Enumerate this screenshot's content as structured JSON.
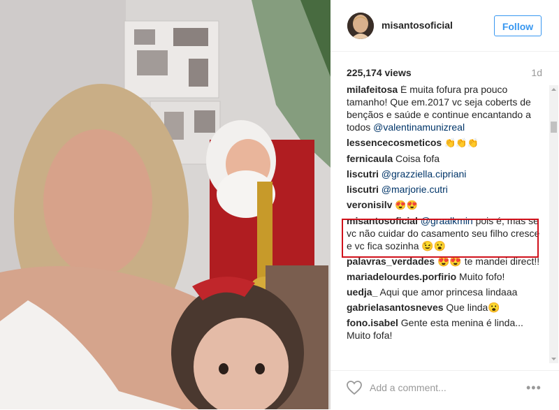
{
  "post": {
    "username": "misantosoficial",
    "follow_label": "Follow",
    "views": "225,174 views",
    "age": "1d"
  },
  "comments": [
    {
      "user": "milafeitosa",
      "text": "É muita fofura pra pouco tamanho! Que em.2017 vc seja coberts de bençãos e saúde e continue encantando a todos",
      "mention": "@valentinamunizreal",
      "after": ""
    },
    {
      "user": "lessencecosmeticos",
      "text": "👏👏👏",
      "mention": "",
      "after": ""
    },
    {
      "user": "fernicaula",
      "text": "Coisa fofa",
      "mention": "",
      "after": ""
    },
    {
      "user": "liscutri",
      "text": "",
      "mention": "@grazziella.cipriani",
      "after": ""
    },
    {
      "user": "liscutri",
      "text": "",
      "mention": "@marjorie.cutri",
      "after": ""
    },
    {
      "user": "veronisilv",
      "text": "😍😍",
      "mention": "",
      "after": ""
    },
    {
      "user": "misantosoficial",
      "text": "",
      "mention": "@graalkmin",
      "after": "pois é, mas se vc não cuidar do casamento seu filho cresce e vc fica sozinha 😉😮"
    },
    {
      "user": "palavras_verdades",
      "text": "😍😍 te mandei direct!!",
      "mention": "",
      "after": ""
    },
    {
      "user": "mariadelourdes.porfirio",
      "text": "Muito fofo!",
      "mention": "",
      "after": ""
    },
    {
      "user": "uedja_",
      "text": "Aqui que amor princesa lindaaa",
      "mention": "",
      "after": ""
    },
    {
      "user": "gabrielasantosneves",
      "text": "Que linda😮",
      "mention": "",
      "after": ""
    },
    {
      "user": "fono.isabel",
      "text": "Gente esta menina é linda... Muito fofa!",
      "mention": "",
      "after": ""
    }
  ],
  "footer": {
    "add_comment_placeholder": "Add a comment...",
    "more_label": "•••"
  },
  "colors": {
    "link": "#003569",
    "follow": "#3897f0",
    "highlight": "#d0111b"
  }
}
